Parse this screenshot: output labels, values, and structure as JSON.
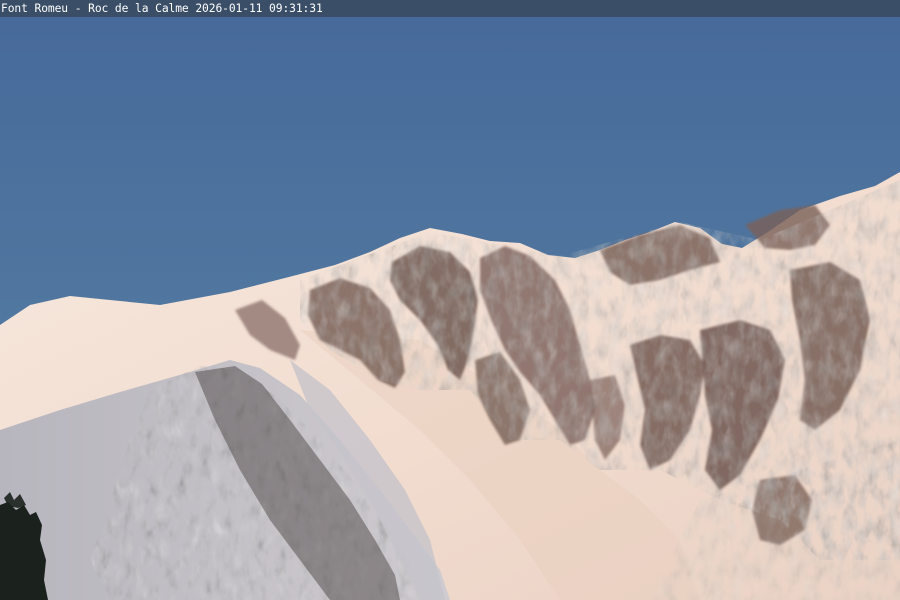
{
  "caption": {
    "text": "Font Romeu - Roc de la Calme 2026-01-11 09:31:31"
  },
  "colors": {
    "sky_top": "#46699a",
    "sky_bottom": "#5a7ea2",
    "snow_lit": "#f6e6dc",
    "snow_warm": "#ecd4c6",
    "snow_shadow": "#c9c9d2",
    "rock_dark": "#5a4a44",
    "rock_mid": "#8a7168",
    "tree": "#1b221d"
  }
}
